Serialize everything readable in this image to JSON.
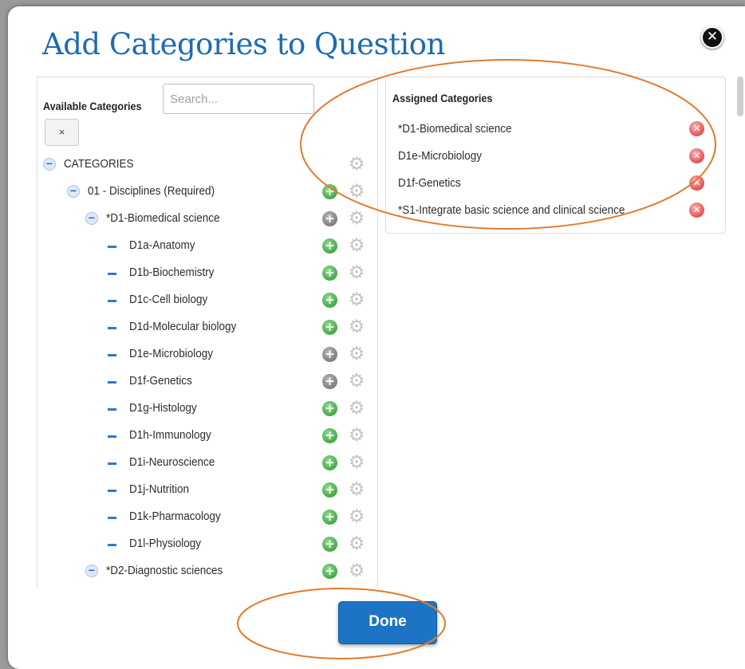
{
  "dialog": {
    "title": "Add Categories to Question",
    "close_icon": "close-x-icon"
  },
  "available": {
    "label": "Available Categories",
    "search_placeholder": "Search...",
    "search_value": "",
    "clear_label": "×",
    "tree": [
      {
        "label": "CATEGORIES",
        "level": 0,
        "expanded": true,
        "add": "none"
      },
      {
        "label": "01 - Disciplines (Required)",
        "level": 1,
        "expanded": true,
        "add": "enabled"
      },
      {
        "label": "*D1-Biomedical science",
        "level": 2,
        "expanded": true,
        "add": "disabled"
      },
      {
        "label": "D1a-Anatomy",
        "level": 3,
        "add": "enabled"
      },
      {
        "label": "D1b-Biochemistry",
        "level": 3,
        "add": "enabled"
      },
      {
        "label": "D1c-Cell biology",
        "level": 3,
        "add": "enabled"
      },
      {
        "label": "D1d-Molecular biology",
        "level": 3,
        "add": "enabled"
      },
      {
        "label": "D1e-Microbiology",
        "level": 3,
        "add": "disabled"
      },
      {
        "label": "D1f-Genetics",
        "level": 3,
        "add": "disabled"
      },
      {
        "label": "D1g-Histology",
        "level": 3,
        "add": "enabled"
      },
      {
        "label": "D1h-Immunology",
        "level": 3,
        "add": "enabled"
      },
      {
        "label": "D1i-Neuroscience",
        "level": 3,
        "add": "enabled"
      },
      {
        "label": "D1j-Nutrition",
        "level": 3,
        "add": "enabled"
      },
      {
        "label": "D1k-Pharmacology",
        "level": 3,
        "add": "enabled"
      },
      {
        "label": "D1l-Physiology",
        "level": 3,
        "add": "enabled"
      },
      {
        "label": "*D2-Diagnostic sciences",
        "level": 2,
        "expanded": true,
        "add": "enabled"
      }
    ]
  },
  "assigned": {
    "label": "Assigned Categories",
    "items": [
      {
        "label": "*D1-Biomedical science"
      },
      {
        "label": "D1e-Microbiology"
      },
      {
        "label": "D1f-Genetics"
      },
      {
        "label": "*S1-Integrate basic science and clinical science"
      }
    ]
  },
  "footer": {
    "done_label": "Done"
  },
  "colors": {
    "title": "#1e6bb0",
    "done_button": "#1e74c4",
    "annotation_circle": "#e07b2e",
    "add_icon": "#46a846",
    "remove_icon": "#e25151"
  }
}
